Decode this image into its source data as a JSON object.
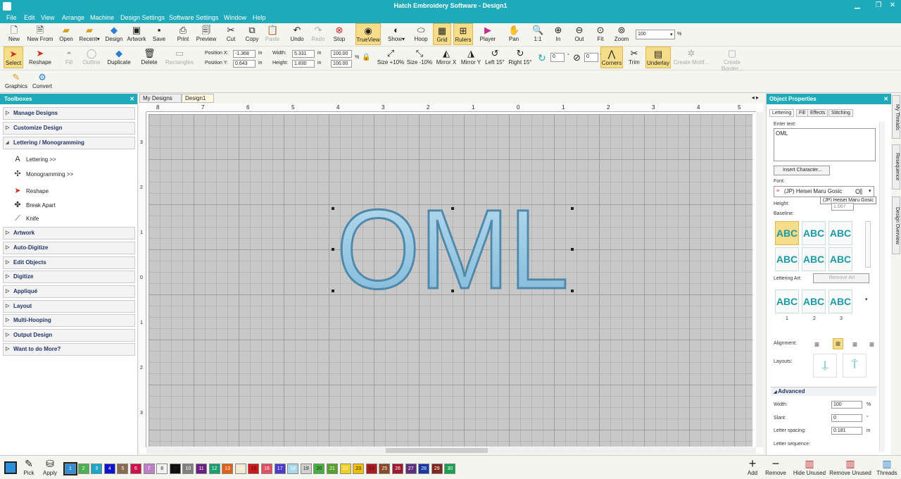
{
  "window": {
    "title": "Hatch Embroidery Software - Design1"
  },
  "menu": [
    "File",
    "Edit",
    "View",
    "Arrange",
    "Machine",
    "Design Settings",
    "Software Settings",
    "Window",
    "Help"
  ],
  "toolbar1": {
    "buttons": [
      "New",
      "New From",
      "Open",
      "Recent",
      "Design",
      "Artwork",
      "Save",
      "Print",
      "Preview",
      "Cut",
      "Copy",
      "Paste",
      "Undo",
      "Redo",
      "Stop",
      "TrueView",
      "Show",
      "Hoop",
      "Grid",
      "Rulers",
      "Player",
      "Pan",
      "1:1",
      "In",
      "Out",
      "Fit",
      "Zoom"
    ],
    "zoom_value": "100",
    "zoom_unit": "%"
  },
  "toolbar2": {
    "buttons": [
      "Select",
      "Reshape",
      "Fill",
      "Outline",
      "Duplicate",
      "Delete",
      "Rectangles",
      "Size +10%",
      "Size -10%",
      "Mirror X",
      "Mirror Y",
      "Left 15°",
      "Right 15°",
      "Corners",
      "Trim",
      "Underlay",
      "Create Motif...",
      "Create Border..."
    ],
    "pos_x_label": "Position X:",
    "pos_x": "-1.368",
    "pos_y_label": "Position Y:",
    "pos_y": "0.643",
    "width_label": "Width:",
    "width": "5.331",
    "height_label": "Height:",
    "height": "1.830",
    "unit": "in",
    "pct_w": "100.00",
    "pct_h": "100.00",
    "pct": "%",
    "rot_value": "0",
    "slant_value": "0",
    "deg": "°"
  },
  "toolbar3": {
    "buttons": [
      "Graphics",
      "Convert"
    ]
  },
  "toolboxes": {
    "title": "Toolboxes",
    "items": [
      "Manage Designs",
      "Customize Design",
      "Lettering / Monogramming",
      "Artwork",
      "Auto-Digitize",
      "Edit Objects",
      "Digitize",
      "Appliqué",
      "Layout",
      "Multi-Hooping",
      "Output Design",
      "Want to do More?"
    ],
    "sub": [
      "Lettering >>",
      "Monogramming >>",
      "Reshape",
      "Break Apart",
      "Knife"
    ]
  },
  "tabs": [
    "My Designs",
    "Design1"
  ],
  "canvas": {
    "text": "OML",
    "ruler_top": [
      "8",
      "7",
      "6",
      "5",
      "4",
      "3",
      "2",
      "1",
      "0",
      "1",
      "2",
      "3",
      "4",
      "5"
    ],
    "ruler_left": [
      "3",
      "2",
      "1",
      "0",
      "1",
      "2",
      "3"
    ]
  },
  "props": {
    "title": "Object Properties",
    "tabs": [
      "Lettering",
      "Fill",
      "Effects",
      "Stitching"
    ],
    "enter_text_label": "Enter text:",
    "text_value": "OML",
    "insert_char": "Insert Character...",
    "font_label": "Font:",
    "font_value": "(JP) Heisei Maru Gosic",
    "font_tooltip": "(JP) Heisei Maru Gosic",
    "height_label": "Height:",
    "height_value": "1.007",
    "baseline_label": "Baseline:",
    "lettering_art_label": "Lettering Art:",
    "remove_art": "Remove Art",
    "art_nums": [
      "1",
      "2",
      "3"
    ],
    "alignment_label": "Alignment:",
    "layouts_label": "Layouts:",
    "advanced_label": "Advanced",
    "width_label": "Width:",
    "width_value": "100",
    "width_unit": "%",
    "slant_label": "Slant:",
    "slant_value": "0",
    "slant_unit": "°",
    "spacing_label": "Letter spacing:",
    "spacing_value": "0.181",
    "spacing_unit": "in",
    "sequence_label": "Letter sequence:",
    "abc": "ABC"
  },
  "sidetabs": [
    "My Threads",
    "Resequence",
    "Design Overview"
  ],
  "bottom": {
    "pick": "Pick",
    "apply": "Apply",
    "swatch_numbers": [
      "1",
      "2",
      "3",
      "4",
      "5",
      "6",
      "7",
      "8",
      "9",
      "10",
      "11",
      "12",
      "13",
      "14",
      "15",
      "16",
      "17",
      "18",
      "19",
      "20",
      "21",
      "22",
      "23",
      "24",
      "25",
      "26",
      "27",
      "28",
      "29",
      "30"
    ],
    "swatch_colors": [
      "#2f8fd8",
      "#4caf50",
      "#1fa5c9",
      "#1010d0",
      "#8a6a50",
      "#d0104a",
      "#c080c8",
      "#f4f4f4",
      "#101010",
      "#808080",
      "#6a2080",
      "#18a070",
      "#e0601a",
      "#f0e8d0",
      "#d01818",
      "#e05060",
      "#4a3cc8",
      "#a8d8e8",
      "#d0d0d0",
      "#48b040",
      "#58a030",
      "#f0d020",
      "#f0c000",
      "#b01820",
      "#8a4a28",
      "#a01830",
      "#603080",
      "#1838a8",
      "#802820",
      "#18a050"
    ],
    "add": "Add",
    "remove": "Remove",
    "hide_unused": "Hide Unused",
    "remove_unused": "Remove Unused",
    "threads": "Threads"
  }
}
